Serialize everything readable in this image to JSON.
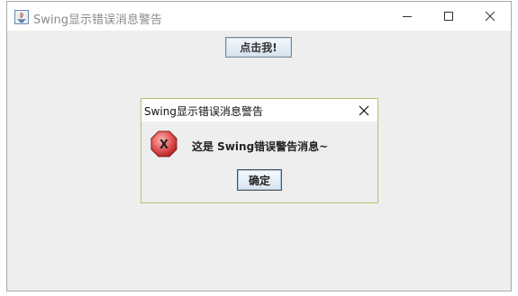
{
  "window": {
    "title": "Swing显示错误消息警告",
    "controls": {
      "minimize_icon": "minimize-icon",
      "maximize_icon": "maximize-icon",
      "close_icon": "close-icon"
    }
  },
  "main": {
    "click_button_label": "点击我!"
  },
  "dialog": {
    "title": "Swing显示错误消息警告",
    "message": "这是 Swing错误警告消息~",
    "ok_label": "确定",
    "icon": "error-icon",
    "border_color": "#a6c86a"
  }
}
